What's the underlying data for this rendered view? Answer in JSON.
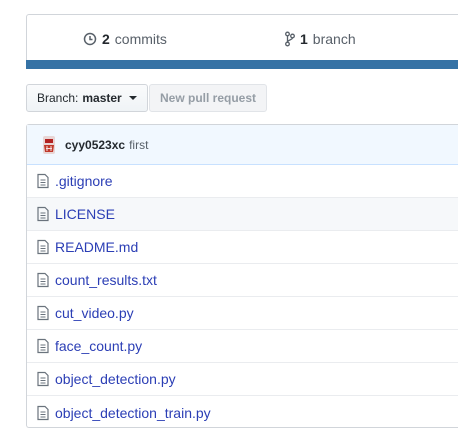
{
  "summary": {
    "commits_count": "2",
    "commits_label": "commits",
    "branches_count": "1",
    "branches_label": "branch"
  },
  "toolbar": {
    "branch_prefix": "Branch:",
    "branch_name": "master",
    "new_pr_label": "New pull request"
  },
  "commit": {
    "author": "cyy0523xc",
    "message": "first"
  },
  "files": [
    {
      "name": ".gitignore"
    },
    {
      "name": "LICENSE"
    },
    {
      "name": "README.md"
    },
    {
      "name": "count_results.txt"
    },
    {
      "name": "cut_video.py"
    },
    {
      "name": "face_count.py"
    },
    {
      "name": "object_detection.py"
    },
    {
      "name": "object_detection_train.py"
    }
  ],
  "colors": {
    "language_bar": "#3572a5",
    "link": "#2b3eb5",
    "commit_bg": "#f1f8ff"
  },
  "icons": {
    "commits": "history-icon",
    "branches": "git-branch-icon",
    "file": "file-text-icon",
    "avatar": "user-avatar"
  }
}
